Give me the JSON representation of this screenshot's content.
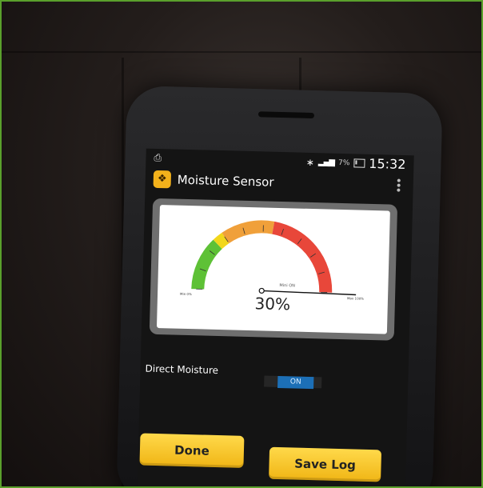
{
  "status_bar": {
    "notification_icon": "file-icon",
    "bluetooth_icon": "bluetooth-icon",
    "signal_icon": "signal-icon",
    "battery_percent": "7%",
    "battery_icon": "battery-icon",
    "time": "15:32"
  },
  "action_bar": {
    "app_icon": "sensor-app-icon",
    "title": "Moisture Sensor",
    "overflow_icon": "overflow-menu-icon"
  },
  "gauge": {
    "value_text": "30%",
    "value": 30,
    "min_label": "Min 0%",
    "max_label": "Max 100%",
    "needle_label": "Mini ON",
    "zones": [
      {
        "from": 0,
        "to": 25,
        "color": "#5ec136"
      },
      {
        "from": 25,
        "to": 30,
        "color": "#f2d71b"
      },
      {
        "from": 30,
        "to": 55,
        "color": "#f0a03a"
      },
      {
        "from": 55,
        "to": 100,
        "color": "#e8473a"
      }
    ]
  },
  "toggle": {
    "label": "Direct Moisture",
    "state": "ON"
  },
  "buttons": {
    "done": "Done",
    "save_log": "Save Log"
  },
  "colors": {
    "frame_border": "#5aa02c",
    "button_yellow": "#f7c62a",
    "toggle_blue": "#1c6fb6"
  }
}
